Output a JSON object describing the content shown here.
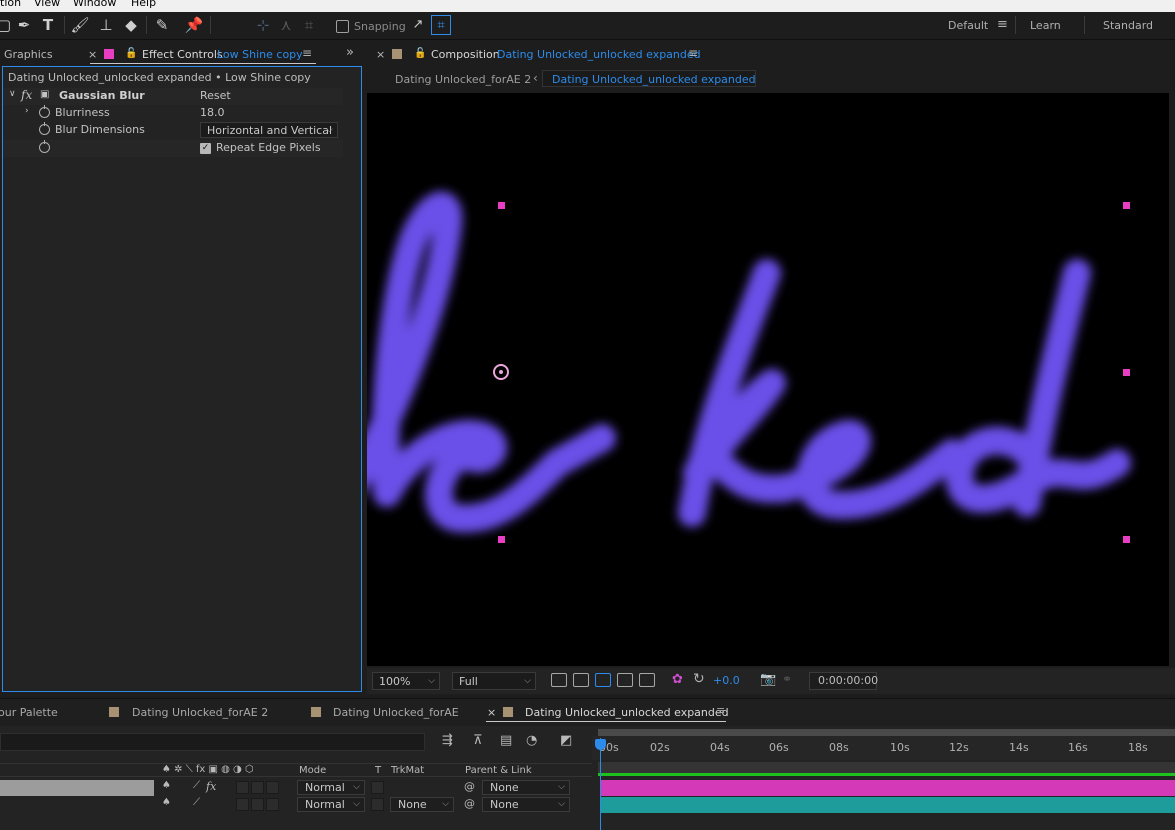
{
  "menu": [
    "tion",
    "View",
    "Window",
    "Help"
  ],
  "toolbar": {
    "snapping_label": "Snapping",
    "workspaces": [
      "Default",
      "Learn",
      "Standard"
    ],
    "active_workspace_icon": "menu-icon"
  },
  "left_panel": {
    "tab_graphics": "Graphics",
    "tab_effect_controls": "Effect Controls",
    "tab_layer": "Low Shine copy",
    "breadcrumb": "Dating Unlocked_unlocked expanded • Low Shine copy",
    "effect": {
      "fx": "fx",
      "name": "Gaussian Blur",
      "reset": "Reset",
      "props": [
        {
          "label": "Blurriness",
          "value": "18.0"
        },
        {
          "label": "Blur Dimensions",
          "value": "Horizontal and Vertical"
        },
        {
          "label": "",
          "value": "Repeat Edge Pixels"
        }
      ]
    }
  },
  "comp_panel": {
    "close": "×",
    "tab_prefix": "Composition",
    "tab_name": "Dating Unlocked_unlocked expanded",
    "crumb_1": "Dating Unlocked_forAE 2",
    "crumb_sep": "‹",
    "crumb_2": "Dating Unlocked_unlocked expanded",
    "viewer_text": "cked",
    "text_color": "#6b4fe8",
    "handle_color": "#e83ec3"
  },
  "viewer_bar": {
    "zoom": "100%",
    "resolution": "Full",
    "exposure": "+0.0",
    "timecode": "0:00:00:00"
  },
  "timeline": {
    "tabs": [
      "our Palette",
      "Dating Unlocked_forAE 2",
      "Dating Unlocked_forAE",
      "Dating Unlocked_unlocked expanded"
    ],
    "close": "×",
    "columns": {
      "mode": "Mode",
      "t": "T",
      "trkmat": "TrkMat",
      "parent": "Parent & Link"
    },
    "ruler": [
      "00s",
      "02s",
      "04s",
      "06s",
      "08s",
      "10s",
      "12s",
      "14s",
      "16s",
      "18s"
    ],
    "layers": [
      {
        "mode": "Normal",
        "trkmat": "",
        "parent": "None",
        "bar_color": "#d43ab8"
      },
      {
        "mode": "Normal",
        "trkmat": "None",
        "parent": "None",
        "bar_color": "#1e9c9c"
      }
    ]
  }
}
